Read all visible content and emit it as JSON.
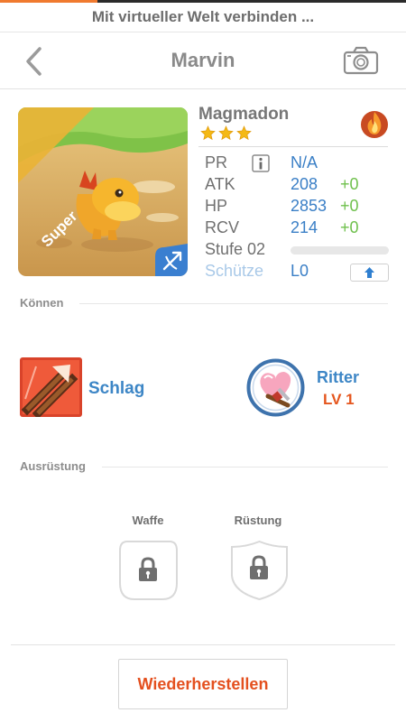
{
  "progress": {
    "fraction": 0.24,
    "color": "#f07a2f"
  },
  "connect_banner": {
    "label": "Mit virtueller Welt verbinden ..."
  },
  "nav": {
    "title": "Marvin",
    "back_icon": "chevron-left-icon",
    "camera_icon": "camera-icon"
  },
  "hero": {
    "name": "Magmadon",
    "rarity_label": "Super",
    "star_count": 3,
    "element_icon": "fire-icon",
    "class_icon": "bow-arrow-icon",
    "stats": [
      {
        "label": "PR",
        "value": "N/A",
        "bonus": ""
      },
      {
        "label": "ATK",
        "value": "208",
        "bonus": "+0"
      },
      {
        "label": "HP",
        "value": "2853",
        "bonus": "+0"
      },
      {
        "label": "RCV",
        "value": "214",
        "bonus": "+0"
      }
    ],
    "level_label": "Stufe 02",
    "level_progress": 0.0,
    "class_name": "Schütze",
    "class_level": "L0"
  },
  "skills": {
    "section_label": "Können",
    "active": {
      "name": "Schlag",
      "icon": "strike-arrows-icon"
    },
    "passive": {
      "name": "Ritter",
      "level": "LV 1",
      "icon": "heart-sword-icon"
    }
  },
  "equipment": {
    "section_label": "Ausrüstung",
    "weapon_label": "Waffe",
    "armor_label": "Rüstung",
    "lock_icon": "lock-icon"
  },
  "restore_button": {
    "label": "Wiederherstellen"
  },
  "colors": {
    "accent": "#e4501f",
    "link_blue": "#3d86c6",
    "bonus_green": "#6fc04c"
  }
}
